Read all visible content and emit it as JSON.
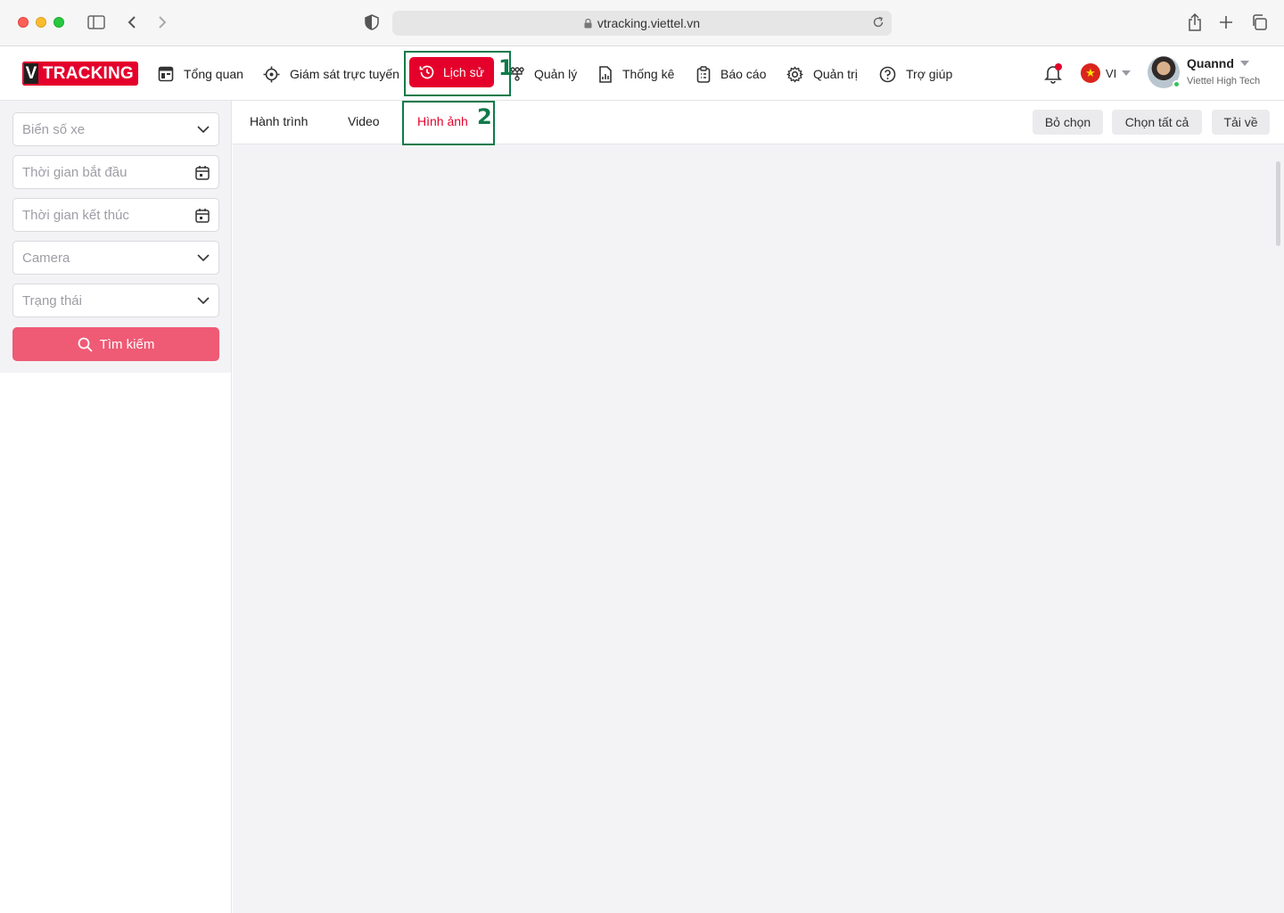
{
  "browser": {
    "url": "vtracking.viettel.vn"
  },
  "logo": {
    "v": "V",
    "text": "TRACKING"
  },
  "nav": {
    "items": [
      {
        "label": "Tổng quan",
        "icon": "dashboard-icon"
      },
      {
        "label": "Giám sát trực tuyến",
        "icon": "target-icon"
      },
      {
        "label": "Lịch sử",
        "icon": "history-icon",
        "active": true
      },
      {
        "label": "Quản lý",
        "icon": "hierarchy-icon"
      },
      {
        "label": "Thống kê",
        "icon": "chart-file-icon"
      },
      {
        "label": "Báo cáo",
        "icon": "clipboard-icon"
      },
      {
        "label": "Quản trị",
        "icon": "gear-icon"
      },
      {
        "label": "Trợ giúp",
        "icon": "help-icon"
      }
    ]
  },
  "annotations": {
    "first": "1",
    "second": "2"
  },
  "language": {
    "code": "VI"
  },
  "user": {
    "name": "Quannd",
    "org": "Viettel High Tech"
  },
  "filters": {
    "plate": "Biển số xe",
    "start_time": "Thời gian bắt đầu",
    "end_time": "Thời gian kết thúc",
    "camera": "Camera",
    "status": "Trạng thái",
    "search_label": "Tìm kiếm"
  },
  "tabs": [
    {
      "label": "Hành trình"
    },
    {
      "label": "Video"
    },
    {
      "label": "Hình ảnh",
      "active": true
    }
  ],
  "toolbar": {
    "deselect": "Bỏ chọn",
    "select_all": "Chọn tất cả",
    "download": "Tải về"
  },
  "colors": {
    "brand": "#e4002b",
    "search_button": "#ef5a75",
    "annotation": "#0f7a4a"
  }
}
